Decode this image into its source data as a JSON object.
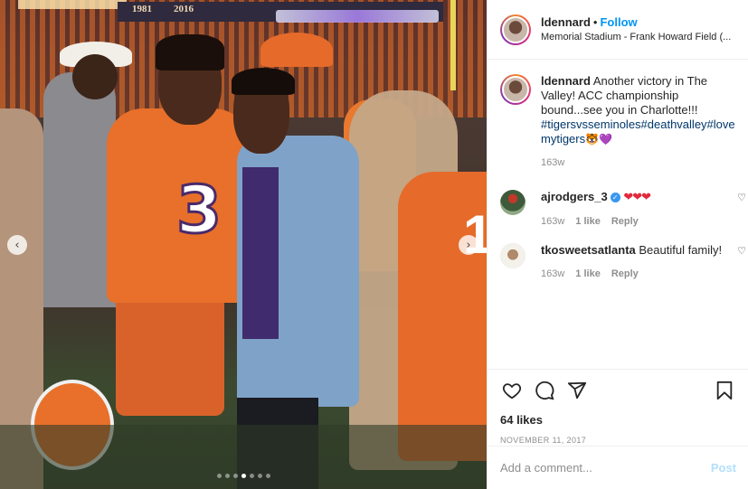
{
  "photo": {
    "banner_years": [
      "1981",
      "2016"
    ],
    "jersey_number": "3",
    "fan_number": "1",
    "carousel": {
      "count": 7,
      "active_index": 3
    },
    "prev_arrow": "‹",
    "next_arrow": "›"
  },
  "header": {
    "username": "ldennard",
    "separator": "•",
    "follow_label": "Follow",
    "location": "Memorial Stadium - Frank Howard Field (..."
  },
  "caption": {
    "username": "ldennard",
    "text": "Another victory in The Valley! ACC championship bound...see you in Charlotte!!! ",
    "hashtags": "#tigersvsseminoles#deathvalley#love mytigers",
    "emoji": "🐯💜",
    "time": "163w"
  },
  "comments": [
    {
      "username": "ajrodgers_3",
      "verified": true,
      "text": "❤❤❤",
      "time": "163w",
      "likes": "1 like",
      "reply": "Reply"
    },
    {
      "username": "tkosweetsatlanta",
      "verified": false,
      "text": "Beautiful family!",
      "time": "163w",
      "likes": "1 like",
      "reply": "Reply"
    }
  ],
  "actions": {
    "likes": "64 likes",
    "date": "NOVEMBER 11, 2017"
  },
  "add_comment": {
    "placeholder": "Add a comment...",
    "post_label": "Post"
  },
  "colors": {
    "link_blue": "#0095f6",
    "hashtag": "#00376b",
    "clemson_orange": "#e8702a",
    "muted": "#8e8e8e"
  }
}
